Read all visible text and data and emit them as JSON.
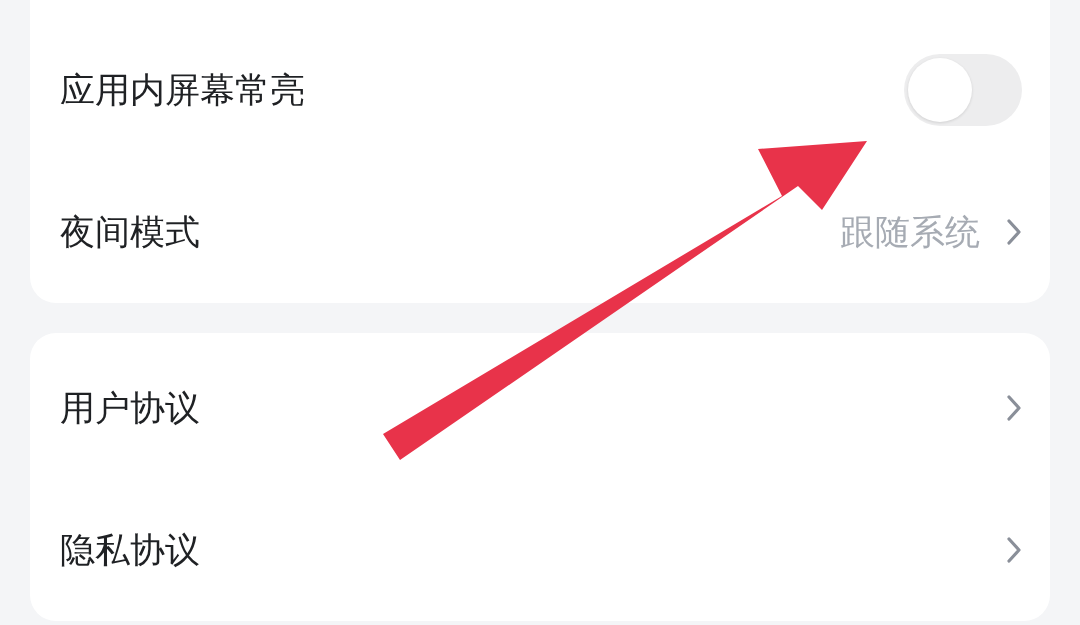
{
  "groups": [
    {
      "items": [
        {
          "kind": "toggle",
          "label": "应用内屏幕常亮",
          "on": false
        },
        {
          "kind": "value",
          "label": "夜间模式",
          "value": "跟随系统"
        }
      ]
    },
    {
      "items": [
        {
          "kind": "link",
          "label": "用户协议"
        },
        {
          "kind": "link",
          "label": "隐私协议"
        }
      ]
    }
  ]
}
